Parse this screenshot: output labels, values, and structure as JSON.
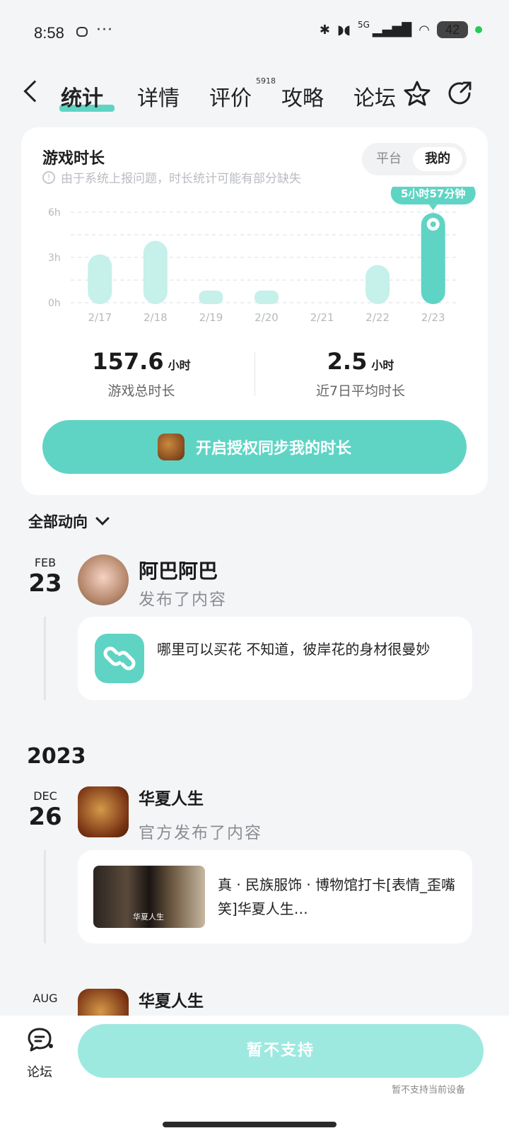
{
  "status_bar": {
    "time": "8:58",
    "dots": "···",
    "network": "5G",
    "battery": "42"
  },
  "nav": {
    "tabs": [
      "统计",
      "详情",
      "评价",
      "攻略",
      "论坛"
    ],
    "review_badge": "5918"
  },
  "stats_card": {
    "title": "游戏时长",
    "notice": "由于系统上报问题，时长统计可能有部分缺失",
    "segment": {
      "option1": "平台",
      "option2": "我的",
      "selected": "我的"
    },
    "total_value": "157.6",
    "total_unit": "小时",
    "total_label": "游戏总时长",
    "avg_value": "2.5",
    "avg_unit": "小时",
    "avg_label": "近7日平均时长",
    "sync_button": "开启授权同步我的时长"
  },
  "chart_data": {
    "type": "bar",
    "categories": [
      "2/17",
      "2/18",
      "2/19",
      "2/20",
      "2/21",
      "2/22",
      "2/23"
    ],
    "values": [
      3.2,
      4.1,
      0.8,
      0.8,
      0,
      2.5,
      5.95
    ],
    "yticks": [
      "6h",
      "3h",
      "0h"
    ],
    "ylim": [
      0,
      6
    ],
    "highlight_index": 6,
    "highlight_label": "5小时57分钟",
    "colors": {
      "bar": "#c6f0ea",
      "highlight": "#5fd4c4"
    }
  },
  "feed": {
    "filter_label": "全部动向",
    "posts": [
      {
        "month": "FEB",
        "day": "23",
        "name": "阿巴阿巴",
        "action": "发布了内容",
        "content": "哪里可以买花 不知道，彼岸花的身材很曼妙"
      },
      {
        "month": "DEC",
        "day": "26",
        "name": "华夏人生",
        "action": "官方发布了内容",
        "content": "真 · 民族服饰 · 博物馆打卡[表情_歪嘴笑]华夏人生…",
        "thumb_caption": "华夏人生"
      },
      {
        "month": "AUG",
        "day": "",
        "name": "华夏人生"
      }
    ],
    "year_label": "2023"
  },
  "bottom_bar": {
    "forum_label": "论坛",
    "action_button": "暂不支持",
    "note": "暂不支持当前设备"
  },
  "colors": {
    "accent": "#5fd4c4",
    "accent_light": "#9de9df"
  }
}
